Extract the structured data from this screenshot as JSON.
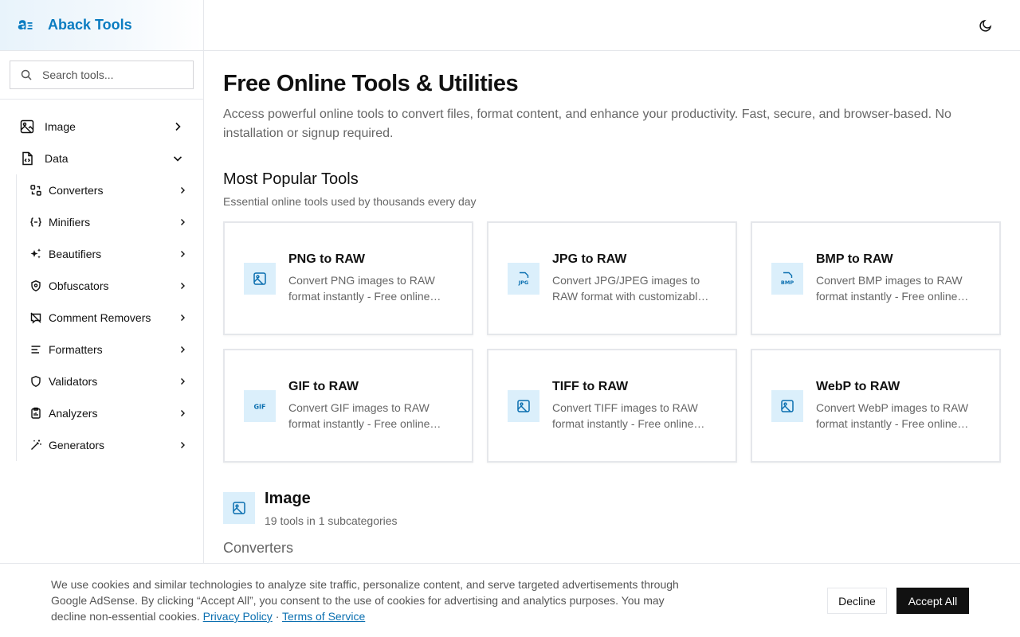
{
  "brand": {
    "name": "Aback Tools"
  },
  "search": {
    "placeholder": "Search tools..."
  },
  "sidebar": {
    "categories": [
      {
        "label": "Image",
        "icon": "image-icon",
        "expanded": false
      },
      {
        "label": "Data",
        "icon": "file-data-icon",
        "expanded": true
      }
    ],
    "subitems": [
      {
        "label": "Converters",
        "icon": "converters-icon"
      },
      {
        "label": "Minifiers",
        "icon": "minifiers-icon"
      },
      {
        "label": "Beautifiers",
        "icon": "sparkles-icon"
      },
      {
        "label": "Obfuscators",
        "icon": "shield-icon"
      },
      {
        "label": "Comment Removers",
        "icon": "comment-off-icon"
      },
      {
        "label": "Formatters",
        "icon": "align-left-icon"
      },
      {
        "label": "Validators",
        "icon": "shield-check-icon"
      },
      {
        "label": "Analyzers",
        "icon": "clipboard-icon"
      },
      {
        "label": "Generators",
        "icon": "wand-icon"
      }
    ]
  },
  "header": {
    "theme_toggle_icon": "moon-icon"
  },
  "main": {
    "title": "Free Online Tools & Utilities",
    "intro": "Access powerful online tools to convert files, format content, and enhance your productivity. Fast, secure, and browser-based. No installation or signup required.",
    "popular_title": "Most Popular Tools",
    "popular_subtitle": "Essential online tools used by thousands every day",
    "tools": [
      {
        "title": "PNG to RAW",
        "desc": "Convert PNG images to RAW format instantly - Free online tool",
        "icon": "image-icon"
      },
      {
        "title": "JPG to RAW",
        "desc": "Convert JPG/JPEG images to RAW format with customizable options",
        "icon": "jpg-file-icon"
      },
      {
        "title": "BMP to RAW",
        "desc": "Convert BMP images to RAW format instantly - Free online tool",
        "icon": "bmp-file-icon"
      },
      {
        "title": "GIF to RAW",
        "desc": "Convert GIF images to RAW format instantly - Free online tool",
        "icon": "gif-icon"
      },
      {
        "title": "TIFF to RAW",
        "desc": "Convert TIFF images to RAW format instantly - Free online tool",
        "icon": "image-icon"
      },
      {
        "title": "WebP to RAW",
        "desc": "Convert WebP images to RAW format instantly - Free online tool",
        "icon": "image-icon"
      }
    ],
    "category": {
      "title": "Image",
      "subtitle": "19 tools in 1 subcategories",
      "subcategory": "Converters"
    }
  },
  "cookie": {
    "text": "We use cookies and similar technologies to analyze site traffic, personalize content, and serve targeted advertisements through Google AdSense. By clicking “Accept All”, you consent to the use of cookies for advertising and analytics purposes. You may decline non-essential cookies.",
    "privacy_label": "Privacy Policy",
    "separator": "·",
    "terms_label": "Terms of Service",
    "decline_label": "Decline",
    "accept_label": "Accept All"
  },
  "colors": {
    "brand": "#0a7cc1",
    "icon_bg": "#dbeffb",
    "icon_fg": "#0a6fb0",
    "accept_bg": "#111111"
  }
}
